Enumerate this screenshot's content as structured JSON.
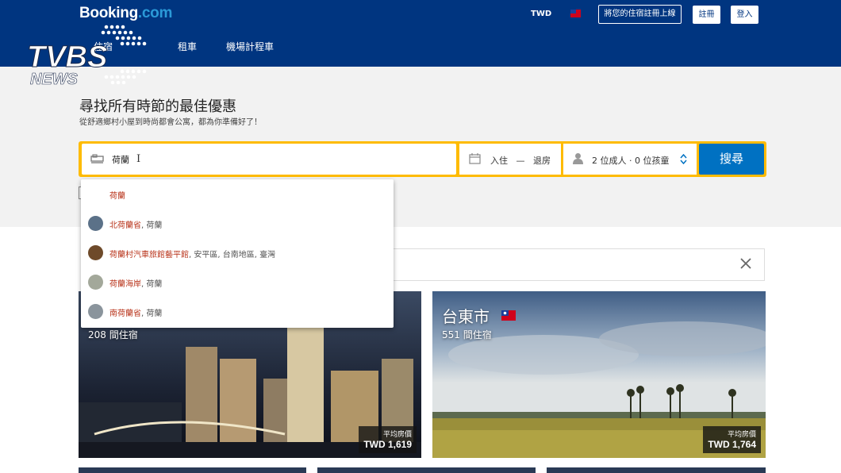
{
  "header": {
    "logo_main": "Booking",
    "logo_suffix": ".com",
    "currency": "TWD",
    "list_property": "將您的住宿註冊上線",
    "register": "註冊",
    "login": "登入",
    "nav": [
      "住宿",
      "租車",
      "機場計程車"
    ]
  },
  "watermark": {
    "main": "TVBS",
    "sub": "NEWS"
  },
  "hero": {
    "title": "尋找所有時節的最佳優惠",
    "subtitle": "從舒適鄉村小屋到時尚都會公寓，都為你準備好了！"
  },
  "search": {
    "destination_value": "荷蘭",
    "checkin": "入住",
    "dash": "—",
    "checkout": "退房",
    "guests": "2 位成人 · 0 位孩童",
    "button": "搜尋"
  },
  "suggestions": [
    {
      "highlight": "荷蘭",
      "rest": ""
    },
    {
      "highlight": "北荷蘭省",
      "rest": ", 荷蘭"
    },
    {
      "highlight": "荷蘭村汽車旅館藝平館",
      "rest": ", 安平區, 台南地區, 臺灣"
    },
    {
      "highlight": "荷蘭海岸",
      "rest": ", 荷蘭"
    },
    {
      "highlight": "南荷蘭省",
      "rest": ", 荷蘭"
    }
  ],
  "cards": [
    {
      "title": "",
      "count": "208 間住宿",
      "price_label": "平均房價",
      "price": "TWD 1,619"
    },
    {
      "title": "台東市",
      "count": "551 間住宿",
      "price_label": "平均房價",
      "price": "TWD 1,764"
    }
  ],
  "colors": {
    "brand": "#003580",
    "accent": "#febb02",
    "button": "#0071c2",
    "highlight": "#b9351c"
  }
}
